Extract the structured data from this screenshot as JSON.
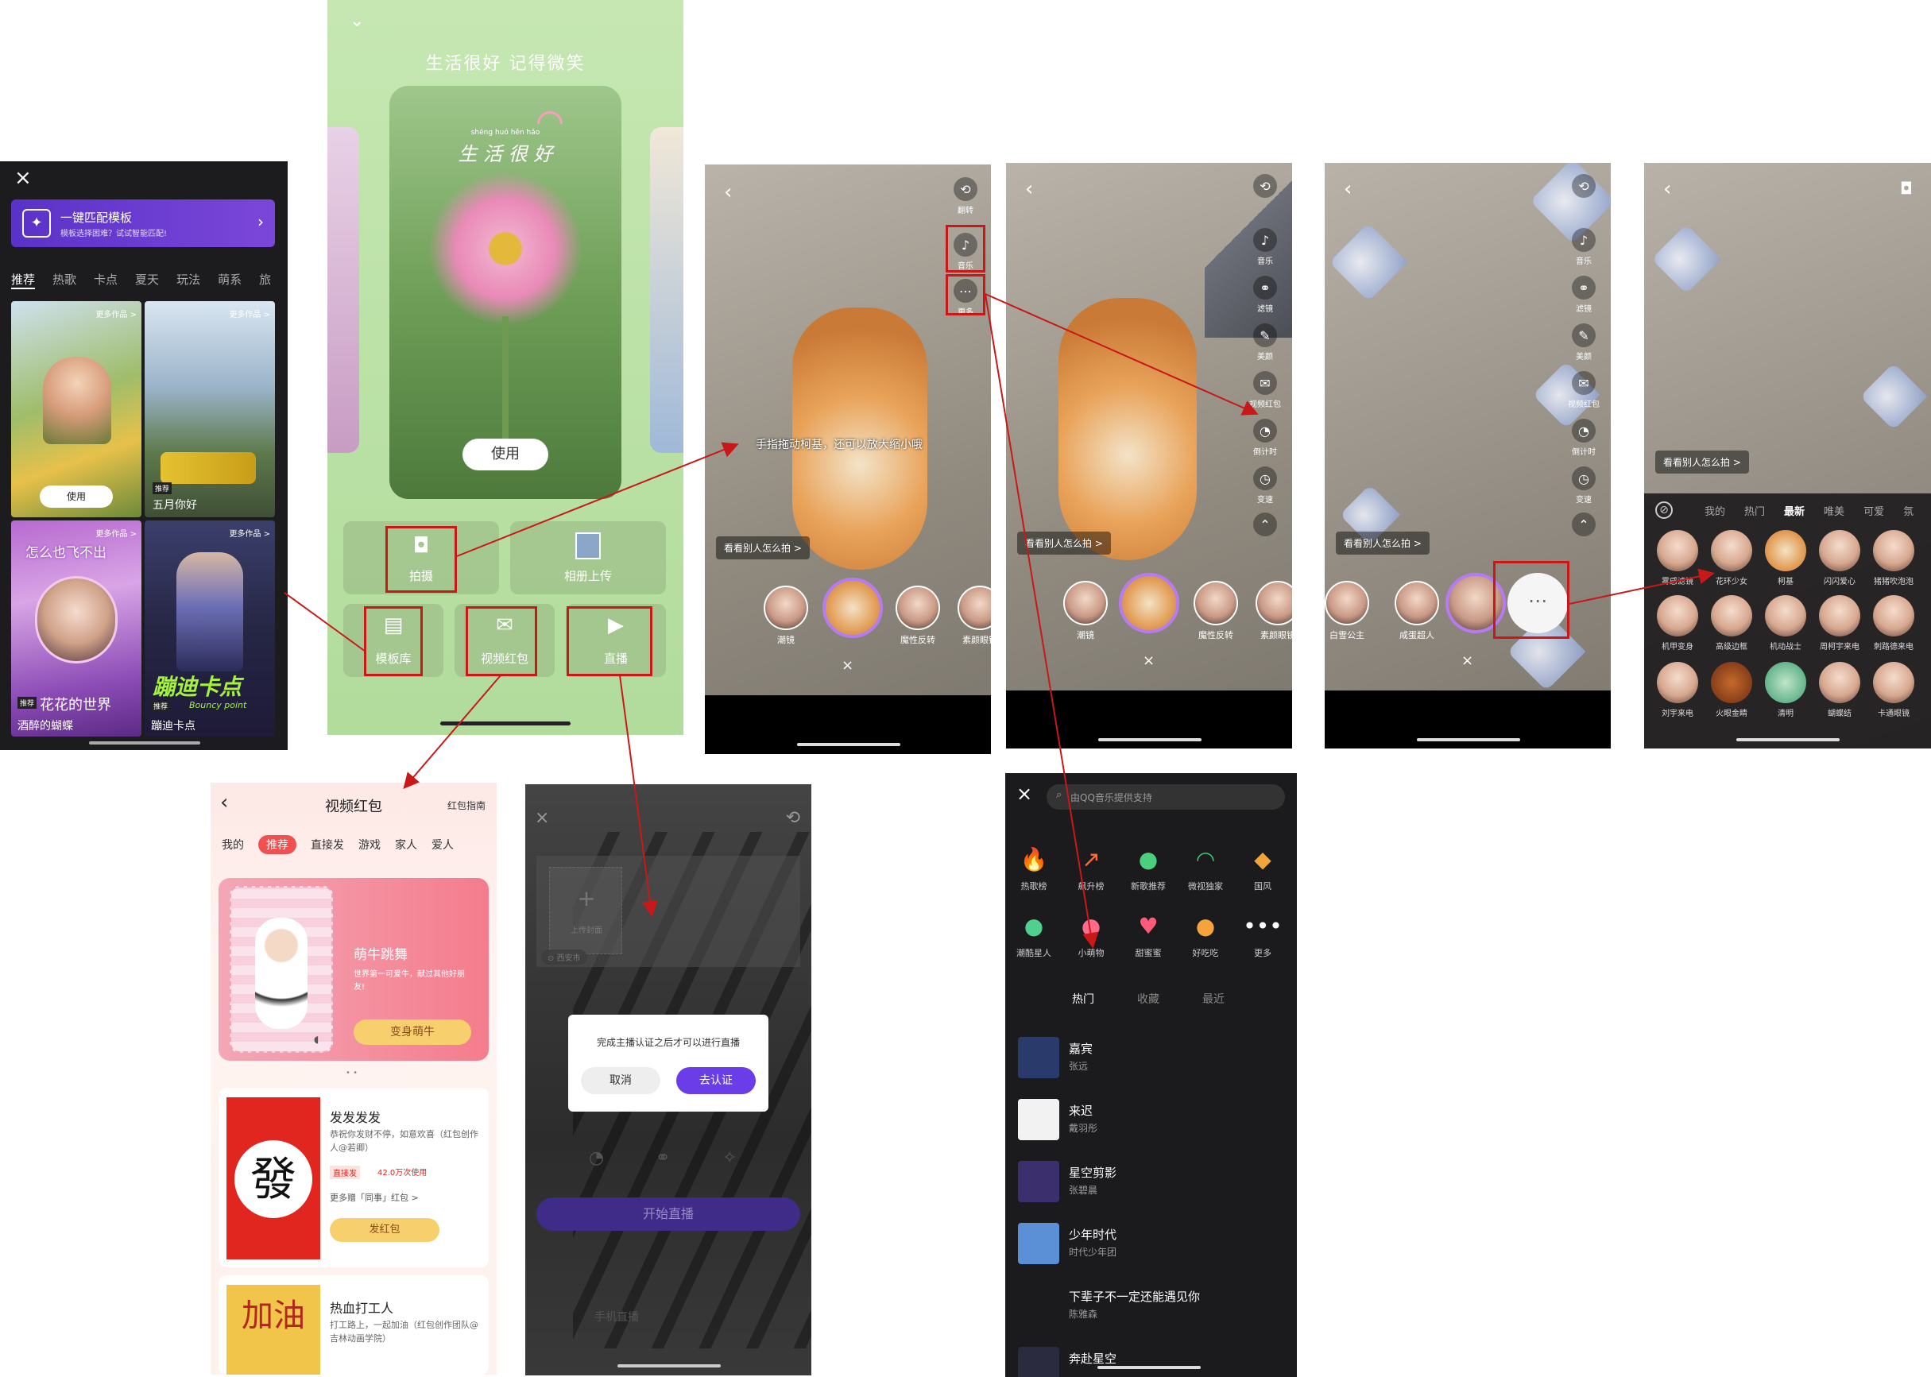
{
  "p1": {
    "close_icon": "close-icon",
    "banner_title": "一键匹配模板",
    "banner_sub": "模板选择困难？试试智能匹配!",
    "tabs": [
      "推荐",
      "热歌",
      "卡点",
      "夏天",
      "玩法",
      "萌系",
      "旅"
    ],
    "more": "更多作品 >",
    "use_label": "使用",
    "card2_badge": "推荐",
    "card2_title": "五月你好",
    "card3_overlay": "怎么也飞不出",
    "card3_title_big": "花花的世界",
    "card3_title": "酒醉的蝴蝶",
    "card3_badge": "推荐",
    "card4_overlay": "蹦迪卡点",
    "card4_overlay_sub": "Bouncy point",
    "card4_badge": "推荐",
    "card4_title": "蹦迪卡点"
  },
  "p2": {
    "header": "生活很好 记得微笑",
    "card_pinyin": "shēng  huó  hěn  hǎo",
    "card_title": "生 活 很 好",
    "use_label": "使用",
    "shoot_label": "拍摄",
    "album_label": "相册上传",
    "template_label": "模板库",
    "redpack_label": "视频红包",
    "live_label": "直播"
  },
  "p3": {
    "hint": "手指拖动柯基，还可以放大缩小哦",
    "see_others": "看看别人怎么拍 >",
    "side": [
      "翻转",
      "音乐",
      "更多"
    ],
    "filters": [
      "潮镜",
      "",
      "魔性反转",
      "素颜眼镜"
    ]
  },
  "p4": {
    "see_others": "看看别人怎么拍 >",
    "side": [
      "",
      "音乐",
      "滤镜",
      "美颜",
      "视频红包",
      "倒计时",
      "变速"
    ],
    "filters": [
      "潮镜",
      "",
      "魔性反转",
      "素颜眼镜"
    ]
  },
  "p5": {
    "see_others": "看看别人怎么拍 >",
    "side": [
      "",
      "音乐",
      "滤镜",
      "美颜",
      "视频红包",
      "倒计时",
      "变速"
    ],
    "filters": [
      "白雪公主",
      "咸蛋超人",
      ""
    ]
  },
  "p6": {
    "see_others": "看看别人怎么拍 >",
    "tabs": [
      "我的",
      "热门",
      "最新",
      "唯美",
      "可爱",
      "氛"
    ],
    "grid": [
      "雾感滤镜",
      "花环少女",
      "柯基",
      "闪闪爱心",
      "猪猪吹泡泡",
      "机甲变身",
      "高级边框",
      "机动战士",
      "周柯宇来电",
      "刺路德来电",
      "刘宇来电",
      "火眼金睛",
      "清明",
      "蝴蝶结",
      "卡通眼镜"
    ]
  },
  "p7": {
    "title": "视频红包",
    "guide": "红包指南",
    "tabs": [
      "我的",
      "推荐",
      "直接发",
      "游戏",
      "家人",
      "爱人"
    ],
    "promo_title": "萌牛跳舞",
    "promo_desc": "世界第一可爱牛，献过其他好朋友!",
    "promo_btn": "变身萌牛",
    "item1_title": "发发发发",
    "item1_desc": "恭祝你发财不停，如意欢喜（红包创作人@若卿）",
    "item1_tag": "直接发",
    "item1_uses": "42.0万次使用",
    "item1_more": "更多赠「同事」红包 >",
    "item1_btn": "发红包",
    "item1_glyph": "發",
    "item2_title": "热血打工人",
    "item2_desc": "打工路上，一起加油（红包创作团队@吉林动画学院）",
    "item2_glyph": "加油"
  },
  "p8": {
    "upload_label": "上传封面",
    "location": "西安市",
    "dialog_text": "完成主播认证之后才可以进行直播",
    "cancel": "取消",
    "confirm": "去认证",
    "start_live": "开始直播",
    "bottom_tabs": "手机直播"
  },
  "p9": {
    "search_placeholder": "由QQ音乐提供支持",
    "icons": [
      {
        "label": "热歌榜",
        "glyph": "🔥",
        "color": "#ff5a4e"
      },
      {
        "label": "飙升榜",
        "glyph": "↗",
        "color": "#ff6b3d"
      },
      {
        "label": "新歌推荐",
        "glyph": "●",
        "color": "#4ccf7c"
      },
      {
        "label": "微视独家",
        "glyph": "◠",
        "color": "#3dc472"
      },
      {
        "label": "国风",
        "glyph": "◆",
        "color": "#f0a43a"
      },
      {
        "label": "潮酷星人",
        "glyph": "●",
        "color": "#4fd08e"
      },
      {
        "label": "小萌物",
        "glyph": "●",
        "color": "#ff6b8a"
      },
      {
        "label": "甜蜜蜜",
        "glyph": "♥",
        "color": "#ff5c7a"
      },
      {
        "label": "好吃吃",
        "glyph": "●",
        "color": "#f5a33b"
      },
      {
        "label": "更多",
        "glyph": "•••",
        "color": "#ffffff"
      }
    ],
    "tabs": [
      "热门",
      "收藏",
      "最近"
    ],
    "songs": [
      {
        "title": "嘉宾",
        "artist": "张远"
      },
      {
        "title": "来迟",
        "artist": "戴羽彤"
      },
      {
        "title": "星空剪影",
        "artist": "张碧晨"
      },
      {
        "title": "少年时代",
        "artist": "时代少年团"
      },
      {
        "title": "下辈子不一定还能遇见你",
        "artist": "陈雅森"
      },
      {
        "title": "奔赴星空",
        "artist": ""
      }
    ]
  },
  "colors": {
    "accent_red": "#c81818",
    "purple": "#6a3de8",
    "green_bg": "#b7dfa6",
    "pink": "#f26a7f"
  }
}
